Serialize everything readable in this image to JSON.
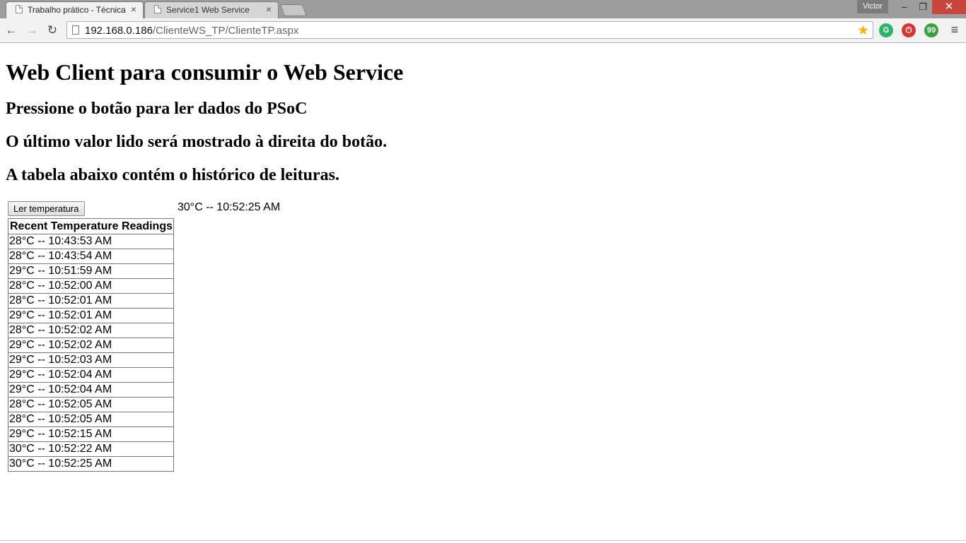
{
  "browser": {
    "tabs": [
      {
        "title": "Trabalho prático - Técnica",
        "close": "×",
        "active": true
      },
      {
        "title": "Service1 Web Service",
        "close": "×",
        "active": false
      }
    ],
    "user": "Victor",
    "window_controls": {
      "minimize": "–",
      "restore": "❐",
      "close": "✕"
    },
    "nav": {
      "back": "←",
      "forward": "→",
      "reload": "↻"
    },
    "address": {
      "host": "192.168.0.186",
      "path": "/ClienteWS_TP/ClienteTP.aspx"
    },
    "star": "★",
    "menu": "≡",
    "extensions": [
      "G",
      "⏻",
      "99"
    ]
  },
  "page": {
    "heading": "Web Client para consumir o Web Service",
    "subheadings": [
      "Pressione o botão para ler dados do PSoC",
      "O último valor lido será mostrado à direita do botão.",
      "A tabela abaixo contém o histórico de leituras."
    ],
    "read_button": "Ler temperatura",
    "last_value": "30°C -- 10:52:25 AM",
    "table": {
      "header": "Recent Temperature Readings",
      "rows": [
        "28°C -- 10:43:53 AM",
        "28°C -- 10:43:54 AM",
        "29°C -- 10:51:59 AM",
        "28°C -- 10:52:00 AM",
        "28°C -- 10:52:01 AM",
        "29°C -- 10:52:01 AM",
        "28°C -- 10:52:02 AM",
        "29°C -- 10:52:02 AM",
        "29°C -- 10:52:03 AM",
        "29°C -- 10:52:04 AM",
        "29°C -- 10:52:04 AM",
        "28°C -- 10:52:05 AM",
        "28°C -- 10:52:05 AM",
        "29°C -- 10:52:15 AM",
        "30°C -- 10:52:22 AM",
        "30°C -- 10:52:25 AM"
      ]
    }
  }
}
